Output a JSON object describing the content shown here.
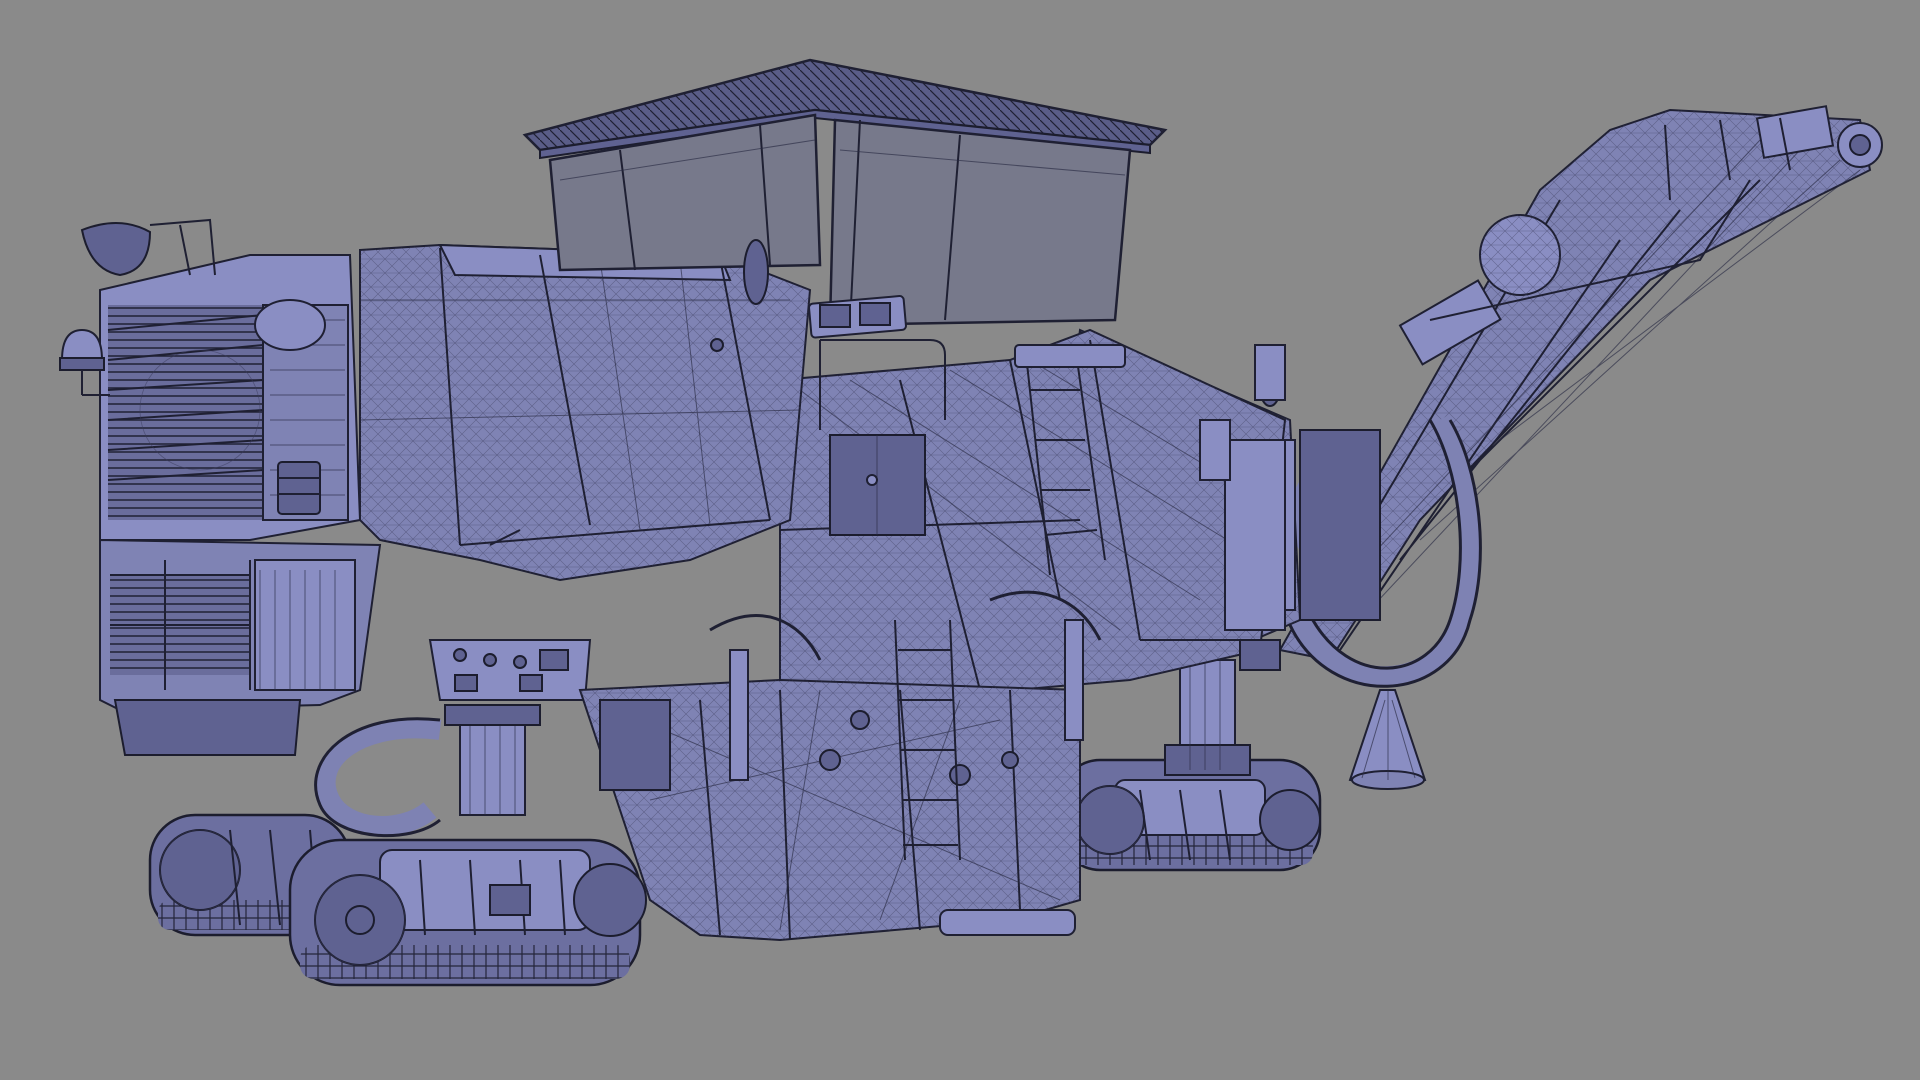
{
  "scene": {
    "subject": "cold-milling-machine-wireframe",
    "background_color": "#8a8a8a",
    "model_color": "#7f83b4",
    "wire_color": "#1f2033",
    "glass_color": "#77798b"
  }
}
